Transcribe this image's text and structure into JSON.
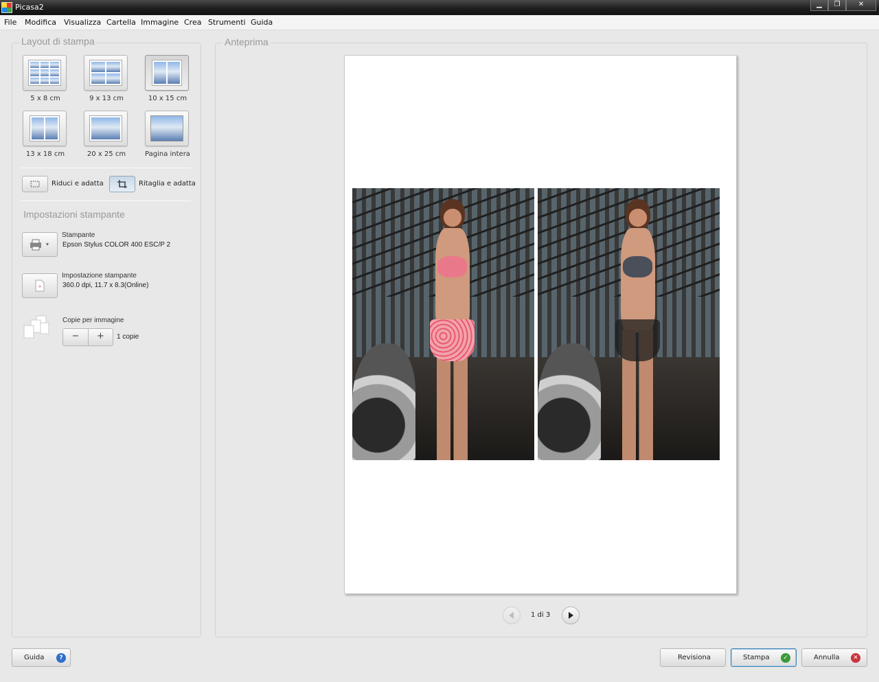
{
  "window": {
    "title": "Picasa2",
    "minimize_glyph": "▁",
    "maximize_glyph": "❐",
    "close_glyph": "✕"
  },
  "menu": [
    "File",
    "Modifica",
    "Visualizza",
    "Cartella",
    "Immagine",
    "Crea",
    "Strumenti",
    "Guida"
  ],
  "layout": {
    "title": "Layout di stampa",
    "sizes": [
      "5 x 8 cm",
      "9 x 13 cm",
      "10 x 15 cm",
      "13 x 18 cm",
      "20 x 25 cm",
      "Pagina intera"
    ],
    "selected": "10 x 15 cm"
  },
  "fit": {
    "shrink_label": "Riduci e adatta",
    "crop_label": "Ritaglia e adatta",
    "selected": "Ritaglia e adatta"
  },
  "printer_settings": {
    "title": "Impostazioni stampante",
    "printer_label": "Stampante",
    "printer_value": "Epson Stylus COLOR 400 ESC/P 2",
    "setup_label": "Impostazione stampante",
    "setup_value": "360.0 dpi, 11.7 x 8.3(Online)",
    "copies_label": "Copie per immagine",
    "minus": "−",
    "plus": "+",
    "copies_value": "1 copie"
  },
  "preview": {
    "title": "Anteprima",
    "page_indicator": "1 di 3"
  },
  "buttons": {
    "help": "Guida",
    "review": "Revisiona",
    "print": "Stampa",
    "cancel": "Annulla"
  },
  "icons": {
    "help": "question-icon",
    "print": "check-icon",
    "cancel": "x-icon",
    "printer": "printer-icon",
    "setup": "page-icon",
    "copies": "stacked-pages-icon"
  },
  "colors": {
    "help_icon": "#2f6fc9",
    "print_icon": "#3a9a3a",
    "cancel_icon": "#c8343a"
  }
}
